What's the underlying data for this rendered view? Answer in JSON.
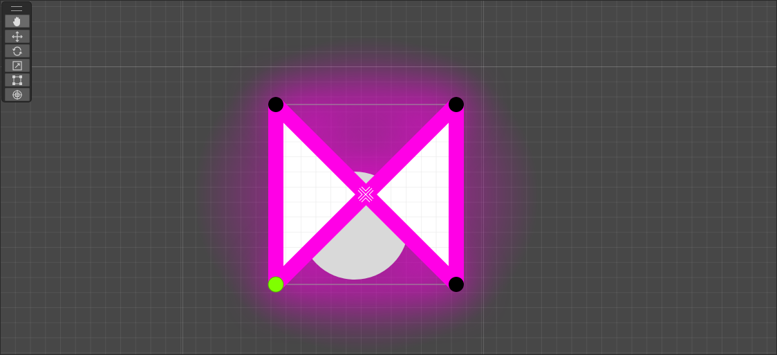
{
  "window": {
    "view": "scene-view"
  },
  "colors": {
    "background": "#474747",
    "shape_stroke": "#ff00e6",
    "shape_glow": "#ff00e6",
    "shape_fill": "#ffffff",
    "circle_sprite": "#d9d9d9",
    "control_point": "#000000",
    "selected_control_point": "#7fff00"
  },
  "toolbar": {
    "tools": [
      {
        "name": "view-tool",
        "icon": "hand-icon",
        "active": true
      },
      {
        "name": "move-tool",
        "icon": "move-arrows-icon",
        "active": false
      },
      {
        "name": "rotate-tool",
        "icon": "rotate-icon",
        "active": false
      },
      {
        "name": "scale-tool",
        "icon": "scale-icon",
        "active": false
      },
      {
        "name": "rect-tool",
        "icon": "rect-transform-icon",
        "active": false
      },
      {
        "name": "transform-tool",
        "icon": "transform-all-icon",
        "active": false
      }
    ]
  },
  "scene": {
    "shape": "bowtie-polygon",
    "control_points": [
      {
        "name": "top-left",
        "selected": false
      },
      {
        "name": "top-right",
        "selected": false
      },
      {
        "name": "bottom-right",
        "selected": false
      },
      {
        "name": "bottom-left",
        "selected": true
      }
    ],
    "pivot_icon": "pivot-gizmo-icon"
  }
}
